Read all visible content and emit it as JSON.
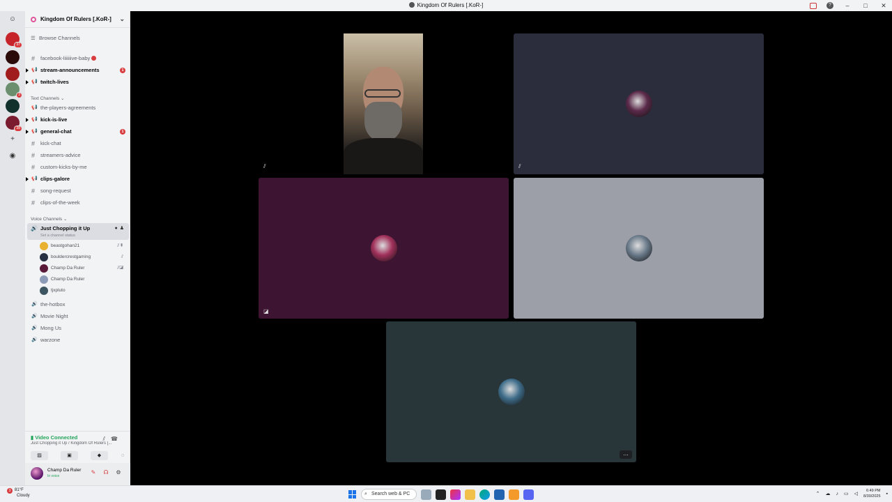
{
  "window": {
    "title": "Kingdom Of Rulers [.KoR-]"
  },
  "server": {
    "name": "Kingdom Of Rulers [.KoR-]",
    "browse_label": "Browse Channels"
  },
  "rail": {
    "servers": [
      {
        "badge": "37",
        "color": "#c6232b"
      },
      {
        "badge": "",
        "color": "#2b0a0a"
      },
      {
        "badge": "",
        "color": "#a11d1d"
      },
      {
        "badge": "3",
        "color": "#6b8f6e"
      },
      {
        "badge": "",
        "color": "#12302c"
      },
      {
        "badge": "38",
        "color": "#7a1b2f"
      }
    ]
  },
  "channels": {
    "top": [
      {
        "name": "facebook-liiiiiive-baby",
        "type": "text",
        "unread": false,
        "dot": true,
        "mention": ""
      },
      {
        "name": "stream-announcements",
        "type": "announce",
        "unread": true,
        "mention": "1"
      },
      {
        "name": "twitch-lives",
        "type": "announce",
        "unread": true,
        "mention": ""
      }
    ],
    "text_category": "Text Channels",
    "text": [
      {
        "name": "the-players-agreements",
        "type": "announce",
        "unread": false,
        "mention": ""
      },
      {
        "name": "kick-is-live",
        "type": "announce",
        "unread": true,
        "mention": ""
      },
      {
        "name": "general-chat",
        "type": "announce",
        "unread": true,
        "mention": "1"
      },
      {
        "name": "kick-chat",
        "type": "text",
        "unread": false,
        "mention": ""
      },
      {
        "name": "streamers-advice",
        "type": "text",
        "unread": false,
        "mention": ""
      },
      {
        "name": "custom-kicks-by-me",
        "type": "text",
        "unread": false,
        "mention": ""
      },
      {
        "name": "clips-galore",
        "type": "announce",
        "unread": true,
        "mention": ""
      },
      {
        "name": "song-request",
        "type": "text",
        "unread": false,
        "mention": ""
      },
      {
        "name": "clips-of-the-week",
        "type": "text",
        "unread": false,
        "mention": ""
      }
    ],
    "voice_category": "Voice Channels",
    "active_voice": {
      "name": "Just Chopping it Up",
      "status": "Set a channel status"
    },
    "voice_users": [
      {
        "name": "beastgohan21",
        "color": "#e8b130"
      },
      {
        "name": "bouldercrestgaming",
        "color": "#273043"
      },
      {
        "name": "Champ Da Ruler",
        "color": "#5a1a3a"
      },
      {
        "name": "Champ Da Ruler",
        "color": "#8e9bb8"
      },
      {
        "name": "tjxpluto",
        "color": "#3d5560"
      }
    ],
    "voice": [
      {
        "name": "the-hotbox"
      },
      {
        "name": "Movie Night"
      },
      {
        "name": "Mong Us"
      },
      {
        "name": "warzone"
      }
    ]
  },
  "voice_panel": {
    "status": "Video Connected",
    "location": "Just Chopping it Up / Kingdom Of Rulers [..."
  },
  "user_panel": {
    "name": "Champ Da Ruler",
    "status": "In voice"
  },
  "tiles": [
    {
      "bg": "#000000",
      "type": "camera"
    },
    {
      "bg": "#2b2d3d",
      "avatar_color": "#5b2a4a"
    },
    {
      "bg": "#3e1433",
      "avatar_color": "#a0305a"
    },
    {
      "bg": "#9d9fa8",
      "avatar_color": "#6a7a8a"
    },
    {
      "bg": "#283539",
      "avatar_color": "#3f6d8a"
    }
  ],
  "taskbar": {
    "temp": "81°F",
    "weather": "Cloudy",
    "search_placeholder": "Search web & PC",
    "time": "6:49 PM",
    "date": "8/30/2025"
  }
}
